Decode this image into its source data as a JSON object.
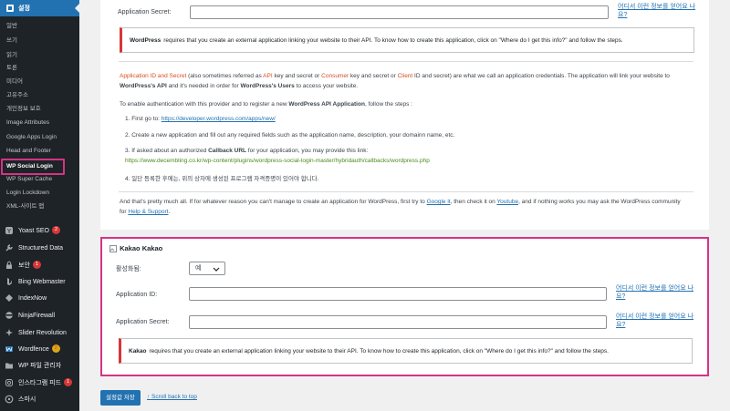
{
  "sidebar": {
    "active_menu": "설정",
    "submenu": [
      "일반",
      "쓰기",
      "읽기",
      "토론",
      "미디어",
      "고유주소",
      "개인정보 보호",
      "Image Attributes",
      "Google Apps Login",
      "Head and Footer",
      "WP Social Login",
      "WP Super Cache",
      "Login Lockdown",
      "XML-사이트 맵"
    ],
    "plugins": [
      {
        "label": "Yoast SEO",
        "badge": "2"
      },
      {
        "label": "Structured Data",
        "badge": ""
      },
      {
        "label": "보안",
        "badge": "1"
      },
      {
        "label": "Bing Webmaster",
        "badge": ""
      },
      {
        "label": "IndexNow",
        "badge": ""
      },
      {
        "label": "NinjaFirewall",
        "badge": ""
      },
      {
        "label": "Slider Revolution",
        "badge": ""
      },
      {
        "label": "Wordfence",
        "badge": "2"
      },
      {
        "label": "WP 파일 관리자",
        "badge": ""
      },
      {
        "label": "인스타그램 피드",
        "badge": "1"
      },
      {
        "label": "스마시",
        "badge": ""
      }
    ]
  },
  "wp_section": {
    "secret_label": "Application Secret:",
    "where_link": "어디서 이런 정보를 얻어요 나요?",
    "notice_brand": "WordPress",
    "notice_text": "requires that you create an external application linking your website to their API. To know how to create this application, click on \"Where do I get this info?\" and follow the steps.",
    "intro_p1_html": "<span class=\"orange\">Application ID and Secret</span> (also sometimes referred as <span class=\"orange\">API</span> key and secret or <span class=\"orange\">Consumer</span> key and secret or <span class=\"orange\">Client</span> ID and secret) are what we call an application credentials. The application will link your website to <b>WordPress's API</b> and it's needed in order for <b>WordPress's Users</b> to access your website.",
    "intro_p2_html": "To enable authentication with this provider and to register a new <b>WordPress API Application</b>, follow the steps :",
    "step1_prefix": "1. First go to:",
    "step1_link": "https://developer.wordpress.com/apps/new/",
    "step2": "2. Create a new application and fill out any required fields such as the application name, description, your domainn name, etc.",
    "step3_html": "3. If asked about an authorized <b>Callback URL</b> for your application, you may provide this link:",
    "callback_url": "https://www.decembling.co.kr/wp-content/plugins/wordpress-social-login-master/hybridauth/callbacks/wordpress.php",
    "step4": "4. 일단 등록한 후에는, 위의 상자에 생성된 프로그램 자격증명이 있어야 합니다.",
    "outro_html": "And that's pretty much all. If for whatever reason you can't manage to create an application for WordPress, first try to <span class=\"lnk\">Google it</span>, then check it on <span class=\"lnk\">Youtube</span>, and if nothing works you may ask the WordPress community for <span class=\"lnk\">Help &amp; Support</span>."
  },
  "kakao": {
    "title": "Kakao Kakao",
    "enabled_label": "활성화됨:",
    "enabled_value": "예",
    "app_id_label": "Application ID:",
    "app_secret_label": "Application Secret:",
    "where_link": "어디서 이런 정보를 얻어요 나요?",
    "notice_brand": "Kakao",
    "notice_text": "requires that you create an external application linking your website to their API. To know how to create this application, click on \"Where do I get this info?\" and follow the steps."
  },
  "footer": {
    "save_label": "설정값 저장",
    "scroll_top": "↑ Scroll back to top"
  },
  "colors": {
    "accent": "#2271b1",
    "highlight": "#d63384",
    "notice_border": "#d63638"
  }
}
